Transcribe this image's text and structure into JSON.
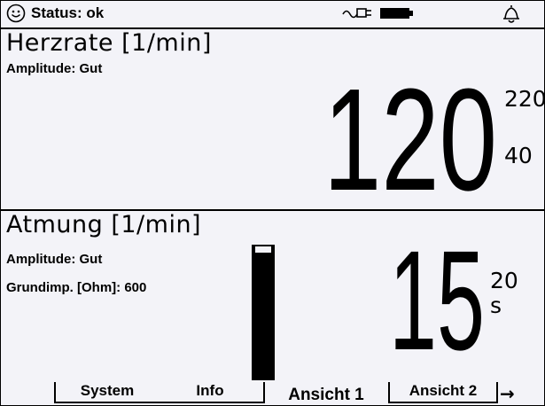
{
  "status": {
    "label": "Status: ok",
    "face_icon": "smiley-icon",
    "power_icon": "plug-icon",
    "battery_icon": "battery-icon",
    "alarm_icon": "bell-icon"
  },
  "heart": {
    "title": "Herzrate [1/min]",
    "amplitude": "Amplitude: Gut",
    "value": "120",
    "upper_limit": "220",
    "lower_limit": "40"
  },
  "respiration": {
    "title": "Atmung [1/min]",
    "amplitude": "Amplitude: Gut",
    "impedance": "Grundimp. [Ohm]: 600",
    "value": "15",
    "limit_value": "20",
    "limit_unit": "s",
    "level": 0.05
  },
  "tabs": {
    "system": "System",
    "info": "Info",
    "view1": "Ansicht 1",
    "view2": "Ansicht 2",
    "next_icon": "arrow-right-icon"
  }
}
